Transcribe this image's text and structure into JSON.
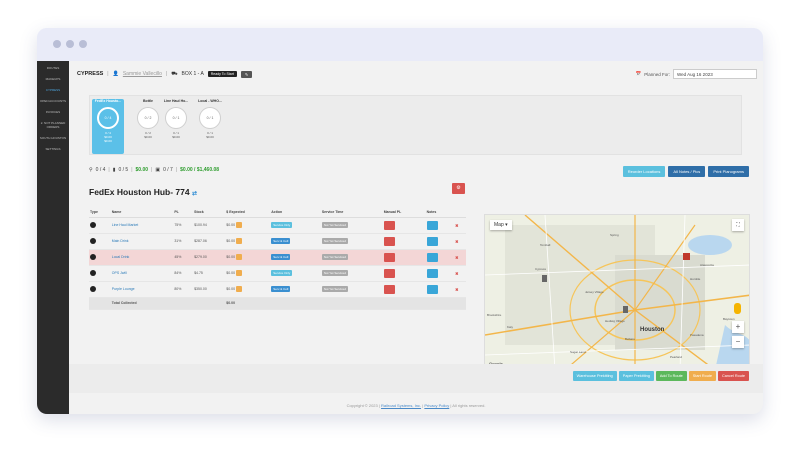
{
  "sidebar": {
    "items": [
      "ROUTES",
      "MAKEUPS",
      "CYPRESS",
      "OPEN ACCOUNTS",
      "INVOICES",
      "2. NOT PLANNED ORDERS",
      "SOUTH HOUSTON",
      "SETTINGS"
    ],
    "active_index": 2
  },
  "topbar": {
    "title": "CYPRESS",
    "driver": "Sammie Vallecillo",
    "box": "BOX 1 - A",
    "status_badge": "Ready To Start",
    "edit_label": "✎"
  },
  "planned": {
    "label": "Planned For:",
    "value": "Wed Aug 16 2023"
  },
  "stops": [
    {
      "name": "FedEx Housto...",
      "circle": "0 / 4",
      "line1": "0 / 4",
      "line2": "$0.00",
      "line3": "$0.00",
      "selected": true
    },
    {
      "name": "Bottle",
      "circle": "0 / 2",
      "line1": "0 / 2",
      "line2": "$0.00",
      "line3": "",
      "selected": false
    },
    {
      "name": "Line Haul Ho...",
      "circle": "0 / 1",
      "line1": "0 / 1",
      "line2": "$0.00",
      "line3": "",
      "selected": false
    },
    {
      "name": "Local - WHO...",
      "circle": "0 / 1",
      "line1": "0 / 1",
      "line2": "$0.00",
      "line3": "",
      "selected": false
    }
  ],
  "summary": {
    "pins": "0 / 4",
    "machines": "0 / 5",
    "money1": "$0.00",
    "boxes": "0 / 7",
    "money2": "$0.00 / $1,460.08"
  },
  "actions": {
    "reorder": "Reorder Locations",
    "notes": "All Notes / Pics",
    "planograms": "Print Planograms"
  },
  "hub": {
    "title": "FedEx Houston Hub- 774"
  },
  "table": {
    "headers": [
      "Type",
      "Name",
      "PL",
      "Stock",
      "$ Expected",
      "Action",
      "Service Time",
      "Manual PL",
      "Notes",
      ""
    ],
    "rows": [
      {
        "name": "Line Haul Market",
        "pl": "75%",
        "stock": "$100.94",
        "expected": "$0.00",
        "action": "Service Only",
        "time": "Not Yet Serviced",
        "err": false,
        "pill": "light"
      },
      {
        "name": "Main Drink",
        "pl": "31%",
        "stock": "$287.06",
        "expected": "$0.00",
        "action": "Serv & Coll",
        "time": "Not Yet Serviced",
        "err": false,
        "pill": "dark"
      },
      {
        "name": "Local Drink",
        "pl": "45%",
        "stock": "$279.00",
        "expected": "$0.00",
        "action": "Serv & Coll",
        "time": "Not Yet Serviced",
        "err": true,
        "pill": "dark"
      },
      {
        "name": "OPS Jwill",
        "pl": "84%",
        "stock": "$4.75",
        "expected": "$0.00",
        "action": "Service Only",
        "time": "Not Yet Serviced",
        "err": false,
        "pill": "light"
      },
      {
        "name": "Purple Lounge",
        "pl": "80%",
        "stock": "$350.00",
        "expected": "$0.00",
        "action": "Serv & Coll",
        "time": "Not Yet Serviced",
        "err": false,
        "pill": "dark"
      }
    ],
    "total_label": "Total Collected",
    "total_value": "$0.00"
  },
  "map": {
    "type_label": "Map",
    "cities": [
      "Cypress",
      "Jersey Village",
      "Spring",
      "Houston",
      "Katy",
      "Sugar Land",
      "Pearland",
      "Pasadena",
      "Baytown",
      "Humble",
      "Atascocita",
      "Tomball",
      "Brookshire",
      "Bellaire",
      "Hedwig Village"
    ],
    "footer": "Keyboard shortcuts  Map data ©2023 Google, INEGI  Terms  Report a map error",
    "google": "Google"
  },
  "bottom": {
    "warehouse": "Warehouse Prekitting",
    "paper": "Paper Prekitting",
    "add": "Add To Route",
    "start": "Start Route",
    "cancel": "Cancel Route"
  },
  "footer": {
    "copyright": "Copyright © 2023 |",
    "company": "Railroad Systems, Inc.",
    "sep": "|",
    "privacy": "Privacy Policy",
    "rights": "| All rights reserved."
  }
}
